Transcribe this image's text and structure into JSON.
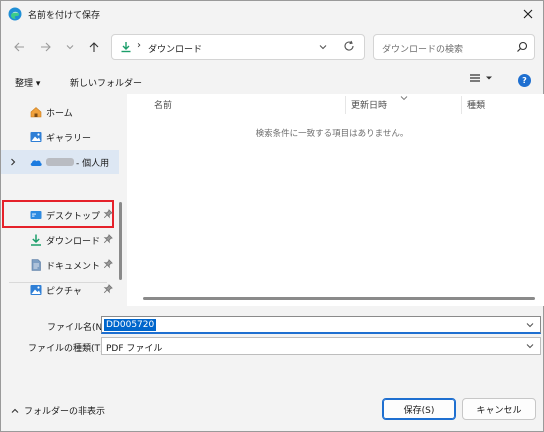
{
  "window": {
    "title": "名前を付けて保存",
    "close_icon": "close-icon"
  },
  "nav": {
    "address_path": "ダウンロード",
    "search_placeholder": "ダウンロードの検索"
  },
  "toolbar": {
    "organize_label": "整理 ▾",
    "new_folder_label": "新しいフォルダー"
  },
  "sidebar": {
    "items": [
      {
        "label": "ホーム",
        "icon": "home-icon"
      },
      {
        "label": "ギャラリー",
        "icon": "gallery-icon"
      },
      {
        "label": "- 個人用",
        "icon": "onedrive-cloud-icon"
      },
      {
        "label": "デスクトップ",
        "icon": "desktop-icon"
      },
      {
        "label": "ダウンロード",
        "icon": "download-icon"
      },
      {
        "label": "ドキュメント",
        "icon": "documents-icon"
      },
      {
        "label": "ピクチャ",
        "icon": "pictures-icon"
      }
    ]
  },
  "list": {
    "columns": [
      "名前",
      "更新日時",
      "種類"
    ],
    "empty_message": "検索条件に一致する項目はありません。"
  },
  "form": {
    "filename_label": "ファイル名(N):",
    "filename_value": "DD005720",
    "filetype_label": "ファイルの種類(T):",
    "filetype_value": "PDF ファイル"
  },
  "footer": {
    "hide_folders_label": "フォルダーの非表示",
    "save_label": "保存(S)",
    "cancel_label": "キャンセル"
  },
  "colors": {
    "accent": "#1e6fd0",
    "highlight_border": "#e5212a",
    "selection": "#0066cc"
  }
}
